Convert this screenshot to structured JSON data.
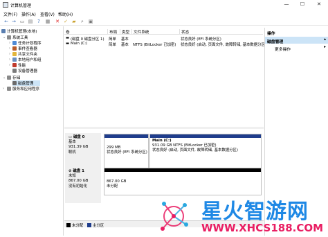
{
  "window": {
    "title": "计算机管理"
  },
  "menu": [
    "文件(F)",
    "操作(A)",
    "查看(V)",
    "帮助(H)"
  ],
  "tree": {
    "root": "计算机管理(本地)",
    "system_tools": "系统工具",
    "task_scheduler": "任务计划程序",
    "event_viewer": "事件查看器",
    "shared_folders": "共享文件夹",
    "local_users": "本地用户和组",
    "performance": "性能",
    "device_manager": "设备管理器",
    "storage": "存储",
    "disk_management": "磁盘管理",
    "services_apps": "服务和应用程序"
  },
  "volumes": {
    "headers": [
      "卷",
      "布局",
      "类型",
      "文件系统",
      "状态"
    ],
    "rows": [
      {
        "vol": "(磁盘 0 磁盘分区 1)",
        "layout": "简单",
        "type": "基本",
        "fs": "",
        "status": "状态良好 (EFI 系统分区)"
      },
      {
        "vol": "Main (C:)",
        "layout": "简单",
        "type": "基本",
        "fs": "NTFS (BitLocker 已加密)",
        "status": "状态良好 (启动, 页面文件, 故障转储, 基本数据分区)"
      }
    ]
  },
  "disks": [
    {
      "name": "磁盘 0",
      "kind": "基本",
      "size": "931.39 GB",
      "state": "联机",
      "partitions": [
        {
          "title": "",
          "size": "299 MB",
          "status": "状态良好 (EFI 系统分区)"
        },
        {
          "title": "Main (C:)",
          "size": "931.09 GB NTFS (BitLocker 已加密)",
          "status": "状态良好 (启动, 页面文件, 故障转储, 基本数据分区)"
        }
      ]
    },
    {
      "name": "磁盘 1",
      "kind": "未知",
      "size": "867.00 GB",
      "state": "没有初始化",
      "partitions": [
        {
          "title": "",
          "size": "867.00 GB",
          "status": "未分配"
        }
      ]
    }
  ],
  "legend": {
    "unallocated": "未分配",
    "primary": "主分区"
  },
  "actions": {
    "title": "操作",
    "section": "磁盘管理",
    "more": "更多操作"
  },
  "watermark": {
    "brand": "星火智游网",
    "url": "WWW.XHCS188.COM"
  },
  "colors": {
    "primary_partition": "#1f3d8c",
    "unallocated": "#000000",
    "selection": "#cce4f7"
  }
}
